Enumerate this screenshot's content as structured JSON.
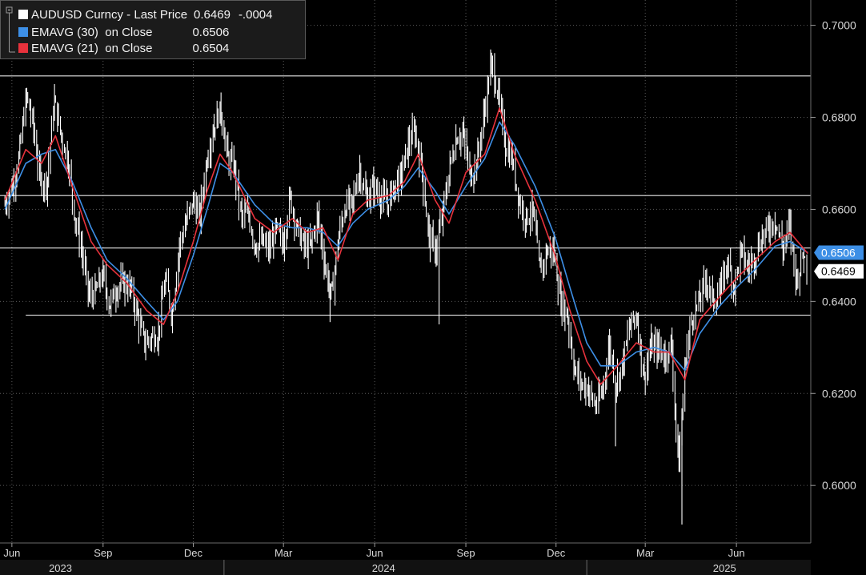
{
  "legend": {
    "price_label": "AUDUSD Curncy - Last Price",
    "price_value": "0.6469",
    "price_change": "-.0004",
    "ema30_label": "EMAVG (30)  on Close",
    "ema30_value": "0.6506",
    "ema21_label": "EMAVG (21)  on Close",
    "ema21_value": "0.6504"
  },
  "colors": {
    "background": "#000000",
    "price": "#ffffff",
    "ema30": "#3d8fe6",
    "ema21": "#e8323c",
    "grid": "#5a5a5a",
    "reference_lines": "#e8e8e8"
  },
  "chart_data": {
    "type": "line",
    "title": "",
    "xlabel": "",
    "ylabel": "",
    "ylim": [
      0.5875,
      0.7055
    ],
    "yticks": [
      0.6,
      0.62,
      0.64,
      0.66,
      0.68,
      0.7
    ],
    "ytick_labels": [
      "0.6000",
      "0.6200",
      "0.6400",
      "0.6600",
      "0.6800",
      "0.7000"
    ],
    "x_month_labels": [
      "Jun",
      "Sep",
      "Dec",
      "Mar",
      "Jun",
      "Sep",
      "Dec",
      "Mar",
      "Jun"
    ],
    "x_month_dates": [
      "2023-06-01",
      "2023-09-01",
      "2023-12-01",
      "2024-03-01",
      "2024-06-01",
      "2024-09-01",
      "2024-12-01",
      "2025-03-01",
      "2025-06-01"
    ],
    "x_year_labels": [
      "2023",
      "2024",
      "2025"
    ],
    "x_range": [
      "2023-05-20",
      "2025-08-15"
    ],
    "grid": "horizontal-dotted",
    "horizontal_reference_lines": [
      0.689,
      0.663,
      0.6516,
      0.637
    ],
    "last_value_labels": [
      {
        "series": "ema30",
        "value": "0.6506"
      },
      {
        "series": "price",
        "value": "0.6469"
      }
    ],
    "series": [
      {
        "key": "price",
        "name": "AUDUSD Curncy - Last Price",
        "points": [
          [
            "2023-05-25",
            0.661
          ],
          [
            "2023-06-02",
            0.665
          ],
          [
            "2023-06-09",
            0.672
          ],
          [
            "2023-06-16",
            0.685
          ],
          [
            "2023-06-23",
            0.678
          ],
          [
            "2023-06-30",
            0.666
          ],
          [
            "2023-07-07",
            0.666
          ],
          [
            "2023-07-14",
            0.684
          ],
          [
            "2023-07-21",
            0.676
          ],
          [
            "2023-07-28",
            0.671
          ],
          [
            "2023-08-04",
            0.658
          ],
          [
            "2023-08-11",
            0.651
          ],
          [
            "2023-08-18",
            0.641
          ],
          [
            "2023-08-25",
            0.642
          ],
          [
            "2023-09-01",
            0.646
          ],
          [
            "2023-09-08",
            0.639
          ],
          [
            "2023-09-15",
            0.643
          ],
          [
            "2023-09-22",
            0.644
          ],
          [
            "2023-09-29",
            0.643
          ],
          [
            "2023-10-06",
            0.637
          ],
          [
            "2023-10-13",
            0.631
          ],
          [
            "2023-10-20",
            0.632
          ],
          [
            "2023-10-27",
            0.633
          ],
          [
            "2023-11-03",
            0.645
          ],
          [
            "2023-11-10",
            0.637
          ],
          [
            "2023-11-17",
            0.652
          ],
          [
            "2023-11-24",
            0.657
          ],
          [
            "2023-12-01",
            0.662
          ],
          [
            "2023-12-08",
            0.658
          ],
          [
            "2023-12-15",
            0.671
          ],
          [
            "2023-12-22",
            0.678
          ],
          [
            "2023-12-29",
            0.682
          ],
          [
            "2024-01-05",
            0.671
          ],
          [
            "2024-01-12",
            0.669
          ],
          [
            "2024-01-19",
            0.658
          ],
          [
            "2024-01-26",
            0.659
          ],
          [
            "2024-02-02",
            0.652
          ],
          [
            "2024-02-09",
            0.653
          ],
          [
            "2024-02-16",
            0.651
          ],
          [
            "2024-02-23",
            0.656
          ],
          [
            "2024-03-01",
            0.652
          ],
          [
            "2024-03-08",
            0.663
          ],
          [
            "2024-03-15",
            0.656
          ],
          [
            "2024-03-22",
            0.652
          ],
          [
            "2024-03-29",
            0.652
          ],
          [
            "2024-04-05",
            0.659
          ],
          [
            "2024-04-12",
            0.648
          ],
          [
            "2024-04-19",
            0.641
          ],
          [
            "2024-04-26",
            0.654
          ],
          [
            "2024-05-03",
            0.661
          ],
          [
            "2024-05-10",
            0.661
          ],
          [
            "2024-05-17",
            0.669
          ],
          [
            "2024-05-24",
            0.662
          ],
          [
            "2024-05-31",
            0.665
          ],
          [
            "2024-06-07",
            0.663
          ],
          [
            "2024-06-14",
            0.661
          ],
          [
            "2024-06-21",
            0.665
          ],
          [
            "2024-06-28",
            0.667
          ],
          [
            "2024-07-05",
            0.674
          ],
          [
            "2024-07-12",
            0.677
          ],
          [
            "2024-07-19",
            0.669
          ],
          [
            "2024-07-26",
            0.654
          ],
          [
            "2024-08-02",
            0.651
          ],
          [
            "2024-08-09",
            0.659
          ],
          [
            "2024-08-16",
            0.669
          ],
          [
            "2024-08-23",
            0.676
          ],
          [
            "2024-08-30",
            0.676
          ],
          [
            "2024-09-06",
            0.667
          ],
          [
            "2024-09-13",
            0.671
          ],
          [
            "2024-09-20",
            0.681
          ],
          [
            "2024-09-27",
            0.692
          ],
          [
            "2024-10-04",
            0.685
          ],
          [
            "2024-10-11",
            0.674
          ],
          [
            "2024-10-18",
            0.671
          ],
          [
            "2024-10-25",
            0.662
          ],
          [
            "2024-11-01",
            0.658
          ],
          [
            "2024-11-08",
            0.66
          ],
          [
            "2024-11-15",
            0.646
          ],
          [
            "2024-11-22",
            0.651
          ],
          [
            "2024-11-29",
            0.651
          ],
          [
            "2024-12-06",
            0.64
          ],
          [
            "2024-12-13",
            0.637
          ],
          [
            "2024-12-20",
            0.625
          ],
          [
            "2024-12-27",
            0.622
          ],
          [
            "2025-01-03",
            0.621
          ],
          [
            "2025-01-10",
            0.617
          ],
          [
            "2025-01-17",
            0.62
          ],
          [
            "2025-01-24",
            0.631
          ],
          [
            "2025-01-31",
            0.622
          ],
          [
            "2025-02-07",
            0.627
          ],
          [
            "2025-02-14",
            0.635
          ],
          [
            "2025-02-21",
            0.637
          ],
          [
            "2025-02-28",
            0.623
          ],
          [
            "2025-03-07",
            0.63
          ],
          [
            "2025-03-14",
            0.63
          ],
          [
            "2025-03-21",
            0.628
          ],
          [
            "2025-03-28",
            0.631
          ],
          [
            "2025-04-04",
            0.603
          ],
          [
            "2025-04-11",
            0.628
          ],
          [
            "2025-04-18",
            0.637
          ],
          [
            "2025-04-25",
            0.64
          ],
          [
            "2025-05-02",
            0.645
          ],
          [
            "2025-05-09",
            0.64
          ],
          [
            "2025-05-16",
            0.642
          ],
          [
            "2025-05-23",
            0.649
          ],
          [
            "2025-05-30",
            0.643
          ],
          [
            "2025-06-06",
            0.651
          ],
          [
            "2025-06-13",
            0.647
          ],
          [
            "2025-06-20",
            0.65
          ],
          [
            "2025-06-27",
            0.654
          ],
          [
            "2025-07-04",
            0.656
          ],
          [
            "2025-07-11",
            0.658
          ],
          [
            "2025-07-18",
            0.651
          ],
          [
            "2025-07-25",
            0.657
          ],
          [
            "2025-08-01",
            0.644
          ],
          [
            "2025-08-08",
            0.651
          ],
          [
            "2025-08-12",
            0.6469
          ]
        ]
      },
      {
        "key": "ema30",
        "name": "EMAVG (30)  on Close",
        "points": [
          [
            "2023-05-25",
            0.66
          ],
          [
            "2023-06-15",
            0.67
          ],
          [
            "2023-07-01",
            0.672
          ],
          [
            "2023-07-15",
            0.673
          ],
          [
            "2023-08-01",
            0.666
          ],
          [
            "2023-08-20",
            0.656
          ],
          [
            "2023-09-05",
            0.649
          ],
          [
            "2023-09-25",
            0.645
          ],
          [
            "2023-10-15",
            0.64
          ],
          [
            "2023-11-01",
            0.636
          ],
          [
            "2023-11-15",
            0.64
          ],
          [
            "2023-12-01",
            0.65
          ],
          [
            "2023-12-15",
            0.66
          ],
          [
            "2023-12-28",
            0.67
          ],
          [
            "2024-01-10",
            0.668
          ],
          [
            "2024-02-01",
            0.661
          ],
          [
            "2024-02-20",
            0.657
          ],
          [
            "2024-03-10",
            0.656
          ],
          [
            "2024-03-25",
            0.656
          ],
          [
            "2024-04-10",
            0.655
          ],
          [
            "2024-04-25",
            0.652
          ],
          [
            "2024-05-10",
            0.657
          ],
          [
            "2024-05-25",
            0.66
          ],
          [
            "2024-06-15",
            0.662
          ],
          [
            "2024-07-01",
            0.665
          ],
          [
            "2024-07-15",
            0.669
          ],
          [
            "2024-08-01",
            0.664
          ],
          [
            "2024-08-15",
            0.659
          ],
          [
            "2024-09-01",
            0.665
          ],
          [
            "2024-09-20",
            0.671
          ],
          [
            "2024-10-05",
            0.679
          ],
          [
            "2024-10-20",
            0.674
          ],
          [
            "2024-11-10",
            0.665
          ],
          [
            "2024-11-30",
            0.654
          ],
          [
            "2024-12-15",
            0.643
          ],
          [
            "2025-01-01",
            0.631
          ],
          [
            "2025-01-15",
            0.626
          ],
          [
            "2025-02-01",
            0.626
          ],
          [
            "2025-02-20",
            0.629
          ],
          [
            "2025-03-10",
            0.63
          ],
          [
            "2025-03-25",
            0.629
          ],
          [
            "2025-04-10",
            0.625
          ],
          [
            "2025-04-25",
            0.633
          ],
          [
            "2025-05-15",
            0.639
          ],
          [
            "2025-06-01",
            0.643
          ],
          [
            "2025-06-20",
            0.647
          ],
          [
            "2025-07-10",
            0.652
          ],
          [
            "2025-07-25",
            0.653
          ],
          [
            "2025-08-12",
            0.6506
          ]
        ]
      },
      {
        "key": "ema21",
        "name": "EMAVG (21)  on Close",
        "points": [
          [
            "2023-05-25",
            0.662
          ],
          [
            "2023-06-15",
            0.673
          ],
          [
            "2023-07-01",
            0.67
          ],
          [
            "2023-07-15",
            0.676
          ],
          [
            "2023-08-01",
            0.665
          ],
          [
            "2023-08-20",
            0.653
          ],
          [
            "2023-09-05",
            0.648
          ],
          [
            "2023-09-25",
            0.644
          ],
          [
            "2023-10-15",
            0.638
          ],
          [
            "2023-11-01",
            0.635
          ],
          [
            "2023-11-15",
            0.642
          ],
          [
            "2023-12-01",
            0.653
          ],
          [
            "2023-12-15",
            0.664
          ],
          [
            "2023-12-28",
            0.672
          ],
          [
            "2024-01-10",
            0.668
          ],
          [
            "2024-02-01",
            0.658
          ],
          [
            "2024-02-20",
            0.655
          ],
          [
            "2024-03-10",
            0.658
          ],
          [
            "2024-03-25",
            0.655
          ],
          [
            "2024-04-10",
            0.656
          ],
          [
            "2024-04-25",
            0.649
          ],
          [
            "2024-05-10",
            0.659
          ],
          [
            "2024-05-25",
            0.662
          ],
          [
            "2024-06-15",
            0.663
          ],
          [
            "2024-07-01",
            0.666
          ],
          [
            "2024-07-15",
            0.672
          ],
          [
            "2024-08-01",
            0.662
          ],
          [
            "2024-08-15",
            0.657
          ],
          [
            "2024-09-01",
            0.668
          ],
          [
            "2024-09-20",
            0.672
          ],
          [
            "2024-10-05",
            0.682
          ],
          [
            "2024-10-20",
            0.672
          ],
          [
            "2024-11-10",
            0.662
          ],
          [
            "2024-11-30",
            0.65
          ],
          [
            "2024-12-15",
            0.638
          ],
          [
            "2025-01-01",
            0.627
          ],
          [
            "2025-01-15",
            0.622
          ],
          [
            "2025-02-01",
            0.626
          ],
          [
            "2025-02-20",
            0.631
          ],
          [
            "2025-03-10",
            0.629
          ],
          [
            "2025-03-25",
            0.629
          ],
          [
            "2025-04-10",
            0.623
          ],
          [
            "2025-04-25",
            0.636
          ],
          [
            "2025-05-15",
            0.641
          ],
          [
            "2025-06-01",
            0.645
          ],
          [
            "2025-06-20",
            0.649
          ],
          [
            "2025-07-10",
            0.653
          ],
          [
            "2025-07-25",
            0.655
          ],
          [
            "2025-08-12",
            0.6504
          ]
        ]
      }
    ]
  }
}
